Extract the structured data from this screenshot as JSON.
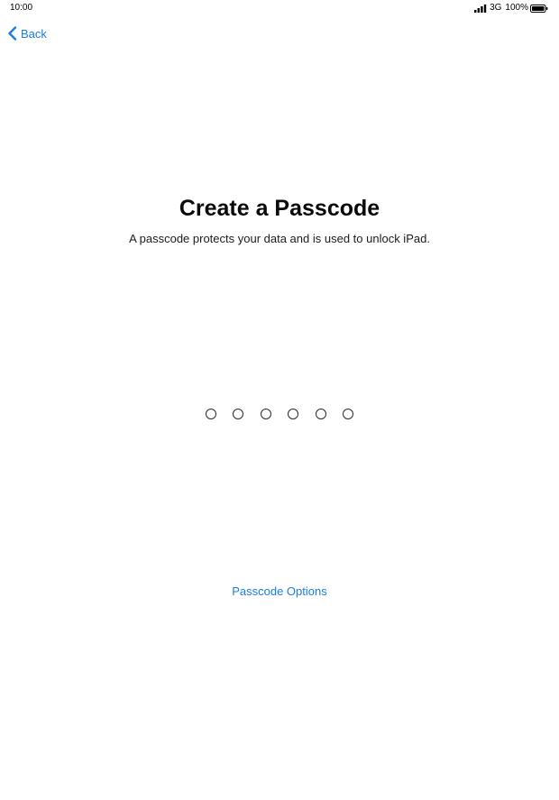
{
  "status_bar": {
    "time": "10:00",
    "network": "3G",
    "battery": "100%"
  },
  "navigation": {
    "back_label": "Back"
  },
  "main": {
    "title": "Create a Passcode",
    "subtitle": "A passcode protects your data and is used to unlock iPad.",
    "passcode_length": 6,
    "options_link": "Passcode Options"
  },
  "colors": {
    "accent": "#1a7fe0",
    "background": "#ffffff",
    "text": "#0a0a0a"
  },
  "icons": {
    "back": "chevron-left-icon",
    "signal": "cellular-signal-icon",
    "battery": "battery-full-icon"
  }
}
